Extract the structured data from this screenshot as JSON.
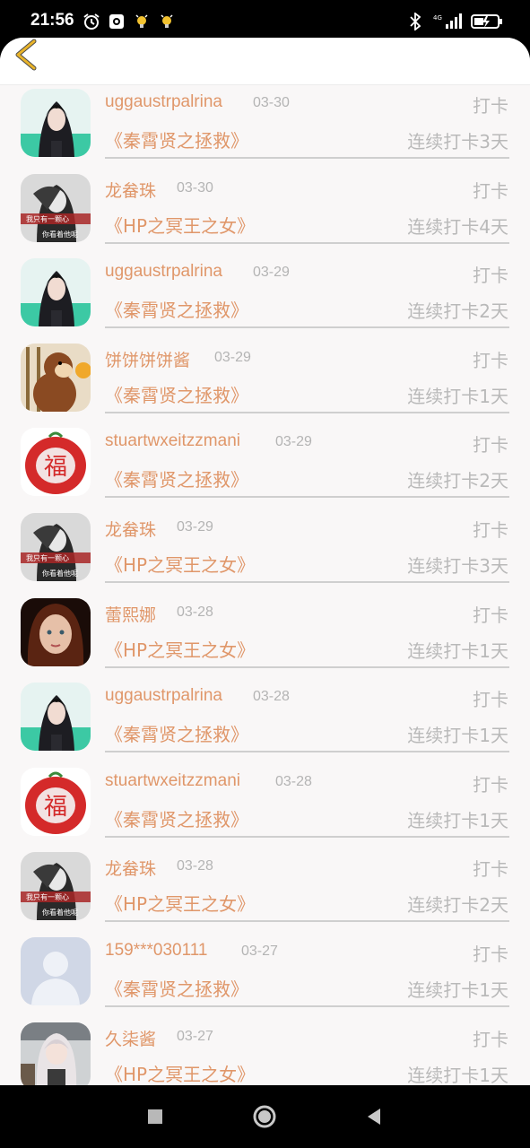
{
  "status": {
    "time": "21:56",
    "left_icons": [
      "alarm-icon",
      "screen-record-icon",
      "bulb-icon",
      "bulb-icon"
    ],
    "right_icons": [
      "bluetooth-icon",
      "signal-4g-icon",
      "battery-charging-icon"
    ]
  },
  "header": {
    "back_icon": "chevron-left-icon",
    "accent": "#e8b32a"
  },
  "records": [
    {
      "name": "uggaustrpalrina",
      "date": "03-30",
      "action": "打卡",
      "book": "《秦霄贤之拯救》",
      "streak": "连续打卡3天",
      "avatar": "girl-teal"
    },
    {
      "name": "龙畚珠",
      "date": "03-30",
      "action": "打卡",
      "book": "《HP之冥王之女》",
      "streak": "连续打卡4天",
      "avatar": "woman-bw"
    },
    {
      "name": "uggaustrpalrina",
      "date": "03-29",
      "action": "打卡",
      "book": "《秦霄贤之拯救》",
      "streak": "连续打卡2天",
      "avatar": "girl-teal"
    },
    {
      "name": "饼饼饼饼酱",
      "date": "03-29",
      "action": "打卡",
      "book": "《秦霄贤之拯救》",
      "streak": "连续打卡1天",
      "avatar": "cartoon-bear"
    },
    {
      "name": "stuartwxeitzzmani",
      "date": "03-29",
      "action": "打卡",
      "book": "《秦霄贤之拯救》",
      "streak": "连续打卡2天",
      "avatar": "red-fu"
    },
    {
      "name": "龙畚珠",
      "date": "03-29",
      "action": "打卡",
      "book": "《HP之冥王之女》",
      "streak": "连续打卡3天",
      "avatar": "woman-bw"
    },
    {
      "name": "蕾熙娜",
      "date": "03-28",
      "action": "打卡",
      "book": "《HP之冥王之女》",
      "streak": "连续打卡1天",
      "avatar": "girl-portrait"
    },
    {
      "name": "uggaustrpalrina",
      "date": "03-28",
      "action": "打卡",
      "book": "《秦霄贤之拯救》",
      "streak": "连续打卡1天",
      "avatar": "girl-teal"
    },
    {
      "name": "stuartwxeitzzmani",
      "date": "03-28",
      "action": "打卡",
      "book": "《秦霄贤之拯救》",
      "streak": "连续打卡1天",
      "avatar": "red-fu"
    },
    {
      "name": "龙畚珠",
      "date": "03-28",
      "action": "打卡",
      "book": "《HP之冥王之女》",
      "streak": "连续打卡2天",
      "avatar": "woman-bw"
    },
    {
      "name": "159***030111",
      "date": "03-27",
      "action": "打卡",
      "book": "《秦霄贤之拯救》",
      "streak": "连续打卡1天",
      "avatar": "default-silhouette"
    },
    {
      "name": "久柒酱",
      "date": "03-27",
      "action": "打卡",
      "book": "《HP之冥王之女》",
      "streak": "连续打卡1天",
      "avatar": "anime-girl"
    }
  ],
  "avatar_texts": {
    "woman_line1": "我只有一颗心",
    "woman_line2": "你看着他呢",
    "fu": "福"
  },
  "nav": {
    "icons": [
      "recent-apps-icon",
      "home-icon",
      "back-triangle-icon"
    ]
  },
  "colors": {
    "name": "#e0976a",
    "muted": "#b9b9b9",
    "date": "#b4b4b4",
    "background": "#f9f7f7"
  }
}
